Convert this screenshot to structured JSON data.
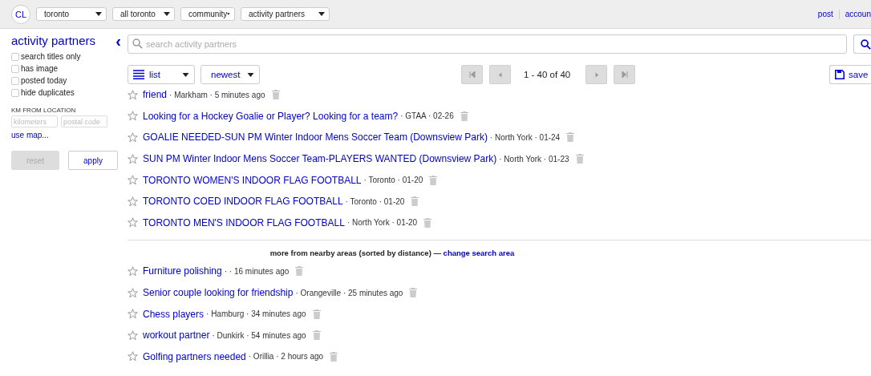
{
  "header": {
    "logo": "CL",
    "selects": [
      "toronto",
      "all toronto",
      "community",
      "activity partners"
    ],
    "links": [
      "post",
      "accoun"
    ]
  },
  "sidebar": {
    "title": "activity partners",
    "collapse": "‹",
    "filters": [
      {
        "label": "search titles only",
        "checked": false
      },
      {
        "label": "has image",
        "checked": false
      },
      {
        "label": "posted today",
        "checked": false
      },
      {
        "label": "hide duplicates",
        "checked": false
      }
    ],
    "km_heading": "KM FROM LOCATION",
    "km_placeholder": "kilometers",
    "postal_placeholder": "postal code",
    "map_link": "use map...",
    "reset": "reset",
    "apply": "apply"
  },
  "search": {
    "placeholder": "search activity partners"
  },
  "toolbar": {
    "view": "list",
    "sort": "newest",
    "range": "1 - 40 of 40",
    "save": "save"
  },
  "results": [
    {
      "title": "friend",
      "meta": "· Markham · 5 minutes ago"
    },
    {
      "title": "Looking for a Hockey Goalie or Player? Looking for a team?",
      "meta": "· GTAA · 02-26"
    },
    {
      "title": "GOALIE NEEDED-SUN PM Winter Indoor Mens Soccer Team (Downsview Park)",
      "meta": "· North York · 01-24"
    },
    {
      "title": "SUN PM Winter Indoor Mens Soccer Team-PLAYERS WANTED (Downsview Park)",
      "meta": "· North York · 01-23"
    },
    {
      "title": "TORONTO WOMEN'S INDOOR FLAG FOOTBALL",
      "meta": "· Toronto · 01-20"
    },
    {
      "title": "TORONTO COED INDOOR FLAG FOOTBALL",
      "meta": "· Toronto · 01-20"
    },
    {
      "title": "TORONTO MEN'S INDOOR FLAG FOOTBALL",
      "meta": "· North York · 01-20"
    }
  ],
  "nearby": {
    "text": "more from nearby areas (sorted by distance) —",
    "link": "change search area"
  },
  "nearby_results": [
    {
      "title": "Furniture polishing",
      "meta": "· · 16 minutes ago"
    },
    {
      "title": "Senior couple looking for friendship",
      "meta": "· Orangeville · 25 minutes ago"
    },
    {
      "title": "Chess players",
      "meta": "· Hamburg · 34 minutes ago"
    },
    {
      "title": "workout partner",
      "meta": "· Dunkirk · 54 minutes ago"
    },
    {
      "title": "Golfing partners needed",
      "meta": "· Orillia · 2 hours ago"
    }
  ]
}
